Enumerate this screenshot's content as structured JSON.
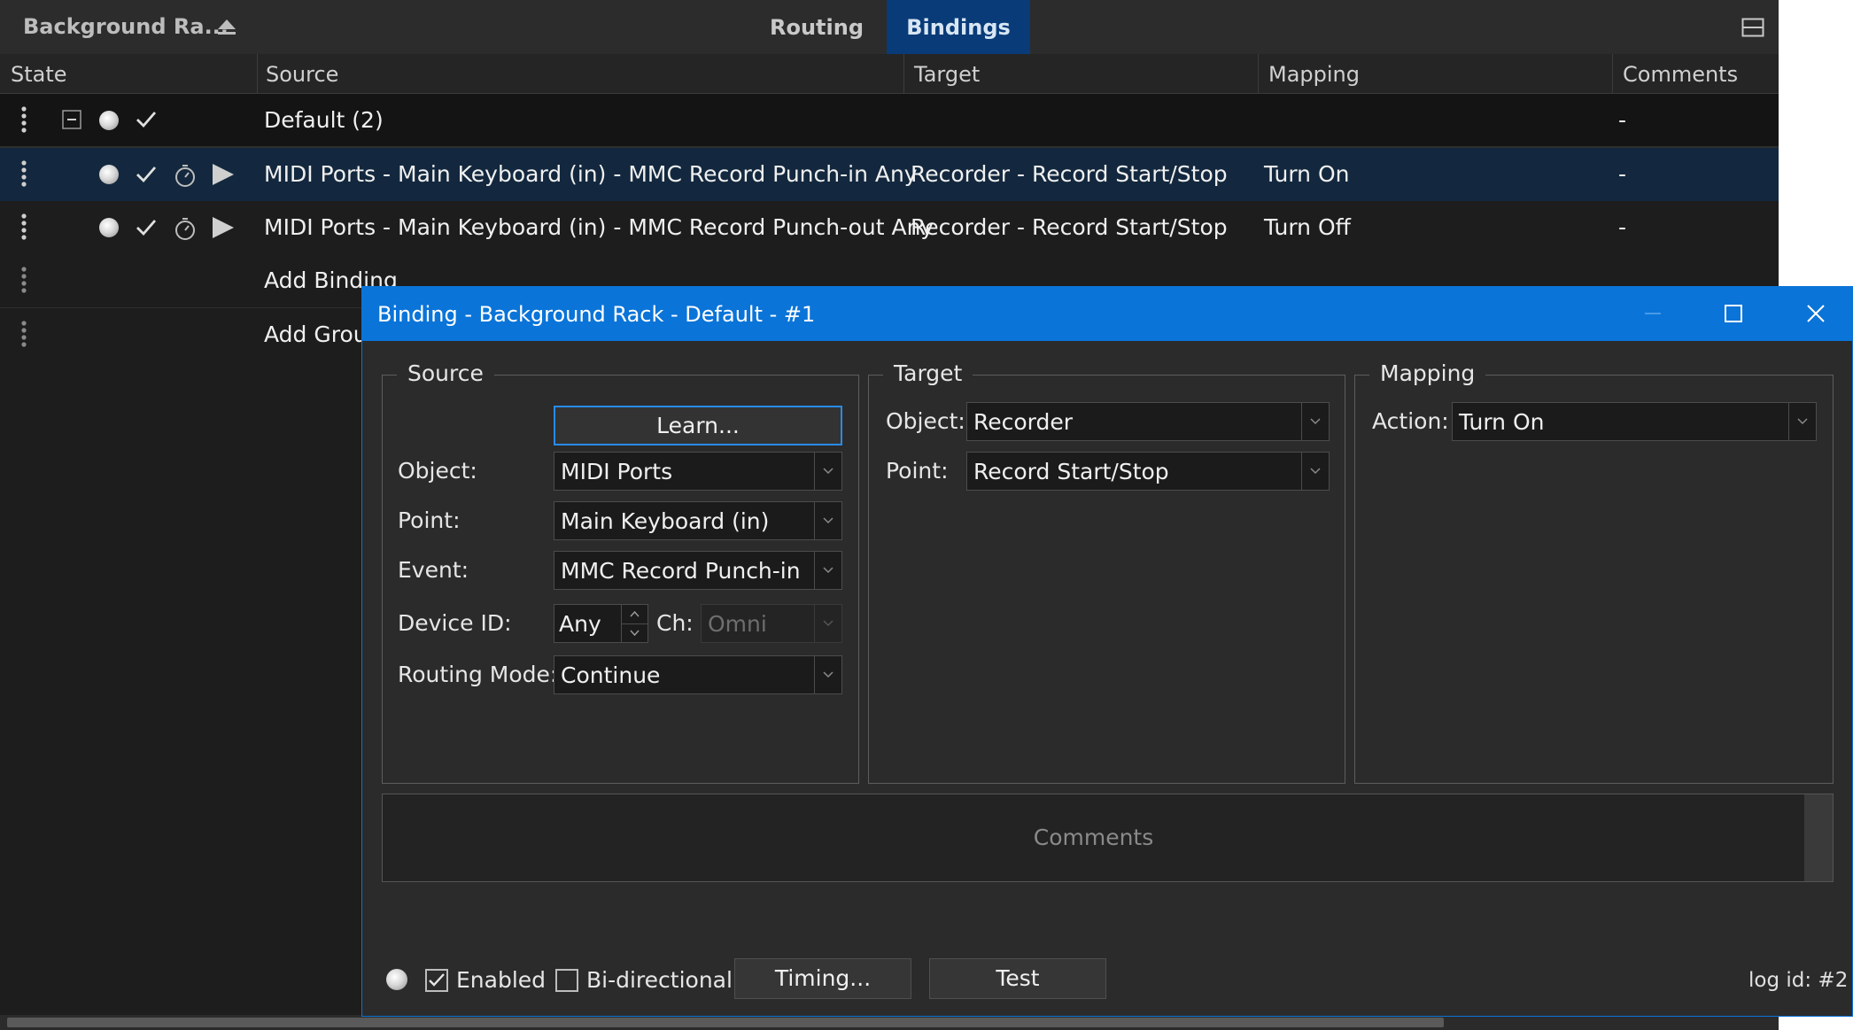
{
  "app": {
    "title": "Background Ra..."
  },
  "tabs": [
    {
      "label": "Routing",
      "active": false
    },
    {
      "label": "Bindings",
      "active": true
    }
  ],
  "columns": [
    "State",
    "Source",
    "Target",
    "Mapping",
    "Comments"
  ],
  "rows": {
    "group": {
      "label": "Default (2)",
      "comments": "-"
    },
    "bindings": [
      {
        "source": "MIDI Ports - Main Keyboard (in) - MMC Record Punch-in Any",
        "target": "Recorder - Record Start/Stop",
        "mapping": "Turn On",
        "comments": "-",
        "selected": true
      },
      {
        "source": "MIDI Ports - Main Keyboard (in) - MMC Record Punch-out Any",
        "target": "Recorder - Record Start/Stop",
        "mapping": "Turn Off",
        "comments": "-",
        "selected": false
      }
    ],
    "add_binding": "Add Binding",
    "add_group": "Add Group"
  },
  "dialog": {
    "title": "Binding - Background Rack - Default - #1",
    "source": {
      "legend": "Source",
      "learn_button": "Learn...",
      "object_label": "Object:",
      "object_value": "MIDI Ports",
      "point_label": "Point:",
      "point_value": "Main Keyboard (in)",
      "event_label": "Event:",
      "event_value": "MMC Record Punch-in",
      "device_id_label": "Device ID:",
      "device_id_value": "Any",
      "ch_label": "Ch:",
      "ch_value": "Omni",
      "routing_mode_label": "Routing Mode:",
      "routing_mode_value": "Continue"
    },
    "target": {
      "legend": "Target",
      "object_label": "Object:",
      "object_value": "Recorder",
      "point_label": "Point:",
      "point_value": "Record Start/Stop"
    },
    "mapping": {
      "legend": "Mapping",
      "action_label": "Action:",
      "action_value": "Turn On"
    },
    "comments_placeholder": "Comments",
    "enabled_label": "Enabled",
    "enabled_checked": true,
    "bidirectional_label": "Bi-directional",
    "bidirectional_checked": false,
    "timing_button": "Timing...",
    "test_button": "Test",
    "log_id": "log id: #2"
  },
  "colors": {
    "accent": "#0a74d8",
    "active_tab": "#083b78",
    "selected_row": "#13283e",
    "window_bg": "#1d1d1d",
    "dialog_bg": "#2b2b2b"
  }
}
